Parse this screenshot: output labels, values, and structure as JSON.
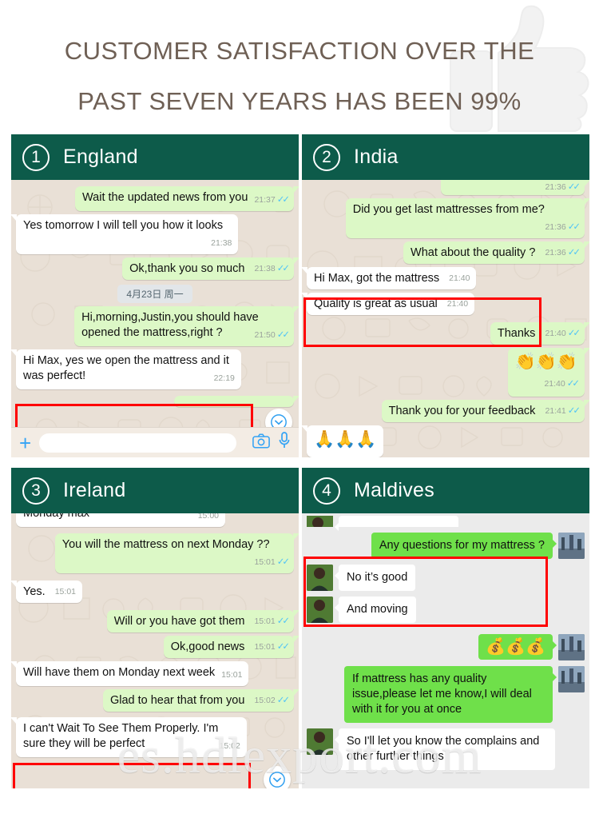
{
  "banner": {
    "title": "CUSTOMER SATISFACTION OVER THE\nPAST SEVEN YEARS HAS BEEN 99%",
    "icon": "thumbs-up-icon",
    "title_color": "#6f6055"
  },
  "watermark": {
    "text": "es.hdlexport.com"
  },
  "theme": {
    "header_green": "#0d5b4a",
    "whatsapp_out_bubble": "#dcf8c6",
    "whatsapp_in_bubble": "#ffffff",
    "whatsapp_background": "#e9e0d6",
    "wechat_out_bubble": "#6fe04a",
    "wechat_background": "#ebebeb",
    "highlight_red": "#ff0000",
    "tick_blue": "#4fc3f7"
  },
  "panels": [
    {
      "number": "1",
      "title": "England",
      "style": "whatsapp",
      "messages": [
        {
          "side": "out",
          "text": "Wait the updated news from you",
          "time": "21:37",
          "ticks": "✓✓"
        },
        {
          "side": "in",
          "text": "Yes tomorrow I will tell you how it looks",
          "time": "21:38",
          "ticks": ""
        },
        {
          "side": "out",
          "text": "Ok,thank you so much",
          "time": "21:38",
          "ticks": "✓✓"
        },
        {
          "type": "date",
          "text": "4月23日 周一"
        },
        {
          "side": "out",
          "text": "Hi,morning,Justin,you should have opened the mattress,right ?",
          "time": "21:50",
          "ticks": "✓✓"
        },
        {
          "side": "in",
          "text": "Hi Max, yes we open the mattress and it was perfect!",
          "time": "22:19",
          "ticks": "",
          "highlight": true
        }
      ],
      "input_bar": {
        "plus": "+",
        "camera_icon": "camera-icon",
        "mic_icon": "microphone-icon"
      },
      "scroll_down_icon": "chevron-down-circle-icon"
    },
    {
      "number": "2",
      "title": "India",
      "style": "whatsapp",
      "messages": [
        {
          "side": "out",
          "text": "",
          "time": "21:36",
          "ticks": "✓✓",
          "partial": true
        },
        {
          "side": "out",
          "text": "Did you get last mattresses from me?",
          "time": "21:36",
          "ticks": "✓✓"
        },
        {
          "side": "out",
          "text": "What about the quality ?",
          "time": "21:36",
          "ticks": "✓✓"
        },
        {
          "side": "in",
          "text": "Hi Max, got the mattress",
          "time": "21:40",
          "ticks": "",
          "highlight": true
        },
        {
          "side": "in",
          "text": "Quality is great as usual",
          "time": "21:40",
          "ticks": "",
          "highlight": true
        },
        {
          "side": "out",
          "text": "Thanks",
          "time": "21:40",
          "ticks": "✓✓"
        },
        {
          "side": "out",
          "emoji": "👏👏👏",
          "time": "21:40",
          "ticks": "✓✓"
        },
        {
          "side": "out",
          "text": "Thank you for your feedback",
          "time": "21:41",
          "ticks": "✓✓"
        },
        {
          "side": "in",
          "emoji": "🙏🙏🙏",
          "time": "",
          "ticks": ""
        }
      ]
    },
    {
      "number": "3",
      "title": "Ireland",
      "style": "whatsapp",
      "messages": [
        {
          "side": "in",
          "text": "Monday max",
          "time": "15:00",
          "ticks": "",
          "partial": true
        },
        {
          "side": "out",
          "text": "You will the mattress on next Monday ??",
          "time": "15:01",
          "ticks": "✓✓"
        },
        {
          "side": "in",
          "text": "Yes.",
          "time": "15:01",
          "ticks": "",
          "inline_time": true
        },
        {
          "side": "out",
          "text": "Will or you have got them",
          "time": "15:01",
          "ticks": "✓✓",
          "inline_time": true
        },
        {
          "side": "out",
          "text": "Ok,good news",
          "time": "15:01",
          "ticks": "✓✓",
          "inline_time": true
        },
        {
          "side": "in",
          "text": "Will have them on Monday next week",
          "time": "15:01",
          "ticks": ""
        },
        {
          "side": "out",
          "text": "Glad to hear that from you",
          "time": "15:02",
          "ticks": "✓✓",
          "inline_time": true
        },
        {
          "side": "in",
          "text": "I can't Wait To See Them Properly.  I'm sure they will be perfect",
          "time": "15:02",
          "ticks": "",
          "highlight": true
        }
      ],
      "scroll_down_icon": "chevron-down-circle-icon"
    },
    {
      "number": "4",
      "title": "Maldives",
      "style": "wechat",
      "messages": [
        {
          "side": "in",
          "text": "",
          "partial": true
        },
        {
          "side": "out",
          "text": "Any questions for my mattress ?"
        },
        {
          "side": "in",
          "text": "No it’s good",
          "highlight": true
        },
        {
          "side": "in",
          "text": "And moving",
          "highlight": true
        },
        {
          "side": "out",
          "emoji": "💰💰💰"
        },
        {
          "side": "out",
          "text": "If mattress has any quality issue,please let me know,I will deal with it for you at once"
        },
        {
          "side": "in",
          "text": "So I'll let you know the complains and other further things"
        }
      ]
    }
  ]
}
